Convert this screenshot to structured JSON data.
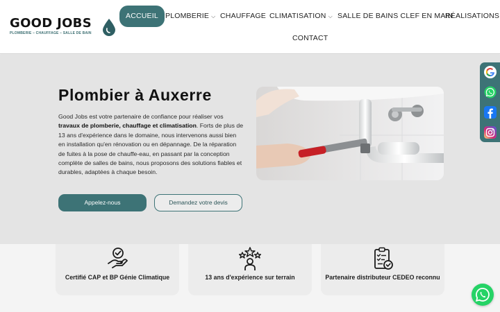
{
  "brand": {
    "name": "GOOD JOBS",
    "tagline": "PLOMBERIE – CHAUFFAGE – SALLE DE BAIN",
    "accent": "#3d7376"
  },
  "nav": {
    "items": [
      {
        "label": "ACCUEIL",
        "active": true
      },
      {
        "label": "PLOMBERIE",
        "dropdown": true
      },
      {
        "label": "CHAUFFAGE"
      },
      {
        "label": "CLIMATISATION",
        "dropdown": true
      },
      {
        "label": "SALLE DE BAINS CLEF EN MAIN"
      },
      {
        "label": "RÉALISATIONS"
      },
      {
        "label": "CONTACT"
      }
    ]
  },
  "hero": {
    "title": "Plombier à Auxerre",
    "text_intro": "Good Jobs est votre partenaire de confiance pour réaliser vos ",
    "text_bold": "travaux de plomberie, chauffage et climatisation",
    "text_rest": ". Forts de plus de 13 ans d'expérience dans le domaine, nous intervenons aussi bien en installation qu'en rénovation ou en dépannage. De la réparation de fuites à la pose de chauffe-eau, en passant par la conception complète de salles de bains, nous proposons des solutions fiables et durables, adaptées à chaque besoin.",
    "cta_primary": "Appelez-nous",
    "cta_secondary": "Demandez votre devis"
  },
  "features": [
    {
      "label": "Certifié CAP et BP Génie Climatique",
      "icon": "certified-hand-icon"
    },
    {
      "label": "13 ans d'expérience sur terrain",
      "icon": "team-stars-icon"
    },
    {
      "label": "Partenaire distributeur CEDEO reconnu",
      "icon": "clipboard-check-icon"
    }
  ],
  "social": [
    "google-icon",
    "whatsapp-icon",
    "facebook-icon",
    "instagram-icon"
  ]
}
